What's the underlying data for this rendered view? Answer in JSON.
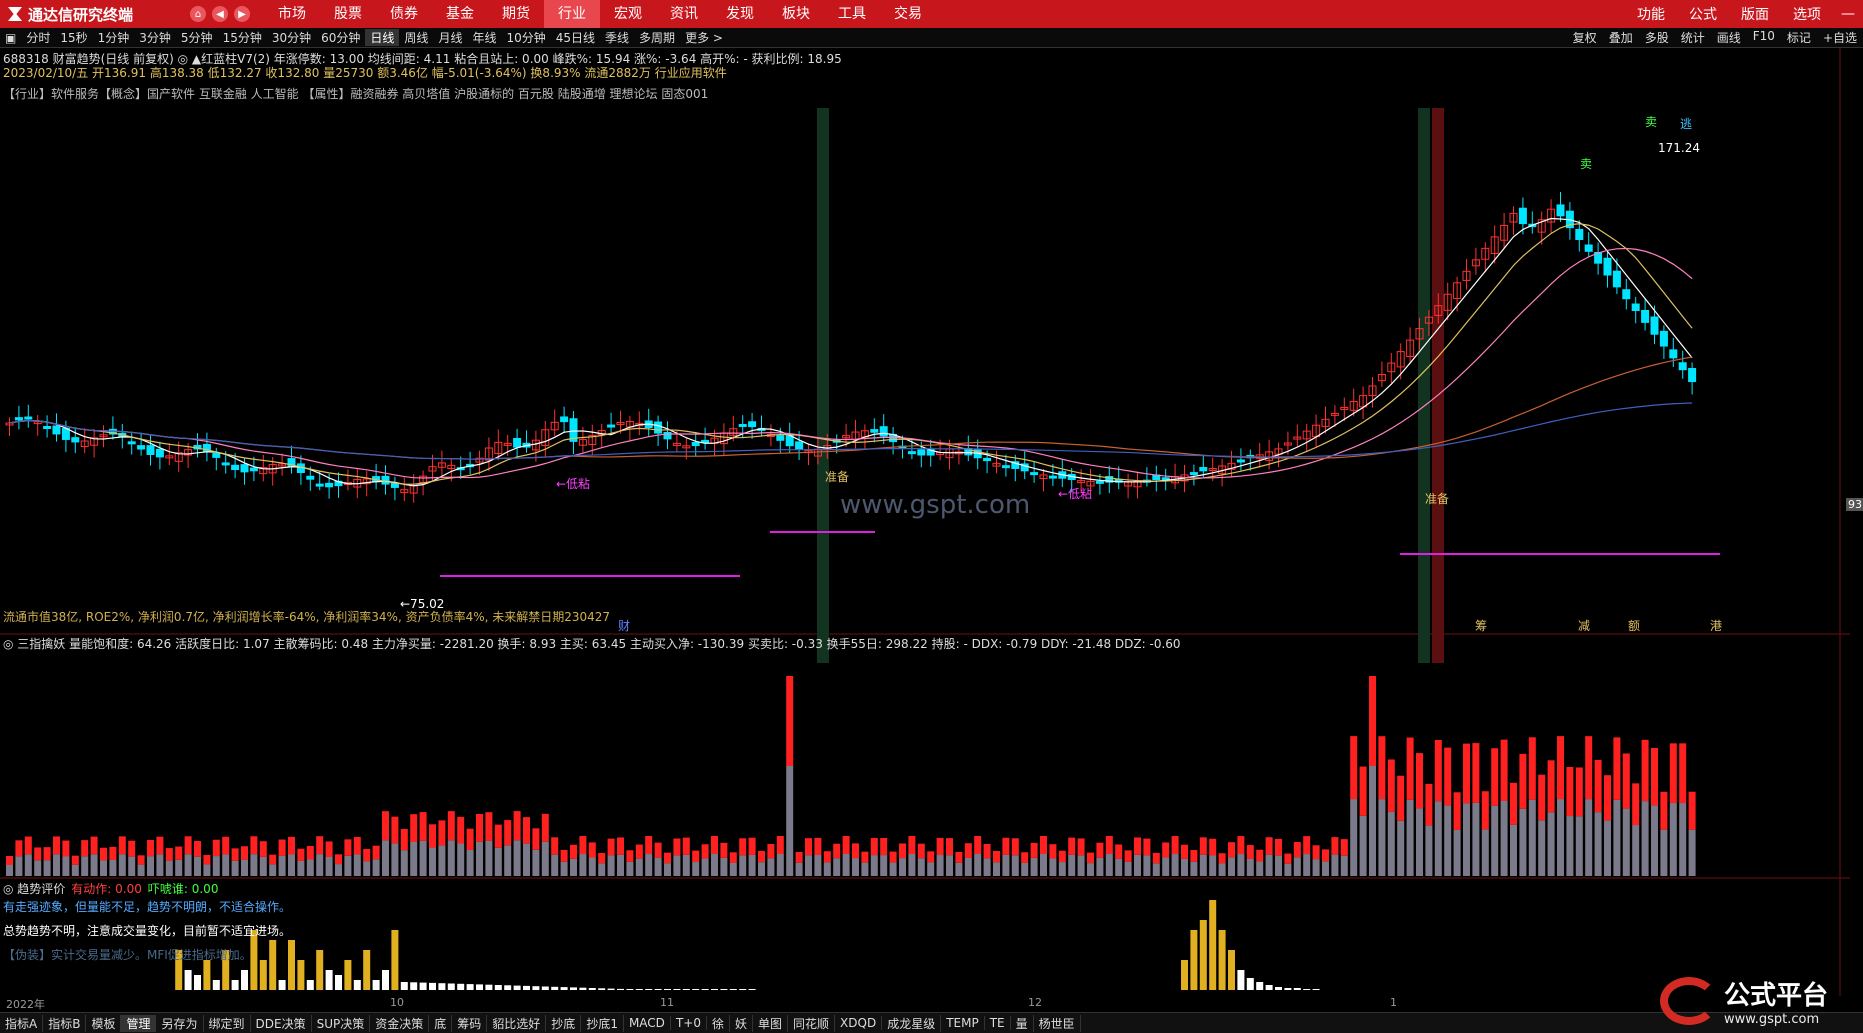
{
  "app": {
    "title": "通达信研究终端"
  },
  "menu": [
    "市场",
    "股票",
    "债券",
    "基金",
    "期货",
    "行业",
    "宏观",
    "资讯",
    "发现",
    "板块",
    "工具",
    "交易"
  ],
  "menu_active": "行业",
  "right_menu": [
    "功能",
    "公式",
    "版面",
    "选项"
  ],
  "timeframes": [
    "分时",
    "15秒",
    "1分钟",
    "3分钟",
    "5分钟",
    "15分钟",
    "30分钟",
    "60分钟",
    "日线",
    "周线",
    "月线",
    "年线",
    "10分钟",
    "45日线",
    "季线",
    "多周期",
    "更多 >"
  ],
  "timeframe_active": "日线",
  "tf_right": [
    "复权",
    "叠加",
    "多股",
    "统计",
    "画线",
    "F10",
    "标记",
    "+自选"
  ],
  "header": {
    "line1": "688318 财富趋势(日线 前复权) ◎ ▲红蓝柱V7(2) 年涨停数: 13.00 均线间距: 4.11 粘合且站上: 0.00 峰跌%: 15.94 涨%: -3.64 高开%: - 获利比例: 18.95",
    "line2": "2023/02/10/五 开136.91 高138.38 低132.27 收132.80 量25730 额3.46亿 幅-5.01(-3.64%) 换8.93% 流通2882万 行业应用软件",
    "line3": "【行业】软件服务【概念】国产软件 互联金融 人工智能 【属性】融资融券 高贝塔值 沪股通标的 百元股 陆股通增 理想论坛 固态001"
  },
  "price_labels": {
    "high": "171.24",
    "low": "75.02",
    "last": "93."
  },
  "markers": {
    "sell": "卖",
    "escape": "逃",
    "prepare": "准备",
    "lowstick": "←低粘"
  },
  "fin_info": "流通市值38亿, ROE2%, 净利润0.7亿, 净利润增长率-64%, 净利润率34%, 资产负债率4%, 未来解禁日期230427",
  "bottom_tags": [
    "财",
    "筹",
    "减",
    "额",
    "港"
  ],
  "indicator1": "◎ 三指擒妖 量能饱和度: 64.26 活跃度日比: 1.07 主散筹码比: 0.48 主力净买量: -2281.20 换手: 8.93 主买: 63.45 主动买入净: -130.39 买卖比: -0.33 换手55日: 298.22 持股: - DDX: -0.79 DDY: -21.48 DDZ: -0.60",
  "indicator2": {
    "title": "◎ 趋势评价",
    "a": "有动作: 0.00",
    "b": "吓唬谁: 0.00"
  },
  "trend_text": {
    "t1": "有走强迹象，但量能不足，趋势不明朗，不适合操作。",
    "t2": "总势趋势不明，注意成交量变化，目前暂不适宜进场。",
    "t3": "【伪装】实计交易量减少。MFI促进指标增加。"
  },
  "dates": [
    "2022年",
    "10",
    "11",
    "12",
    "1"
  ],
  "bottom_tabs": [
    "指标A",
    "指标B",
    "模板",
    "管理",
    "另存为",
    "绑定到",
    "DDE决策",
    "SUP决策",
    "资金决策",
    "底",
    "筹码",
    "貂比选好",
    "抄底",
    "抄底1",
    "MACD",
    "T+0",
    "徐",
    "妖",
    "单图",
    "同花顺",
    "XDQD",
    "成龙星级",
    "TEMP",
    "TE",
    "量",
    "杨世臣"
  ],
  "bottom_tab_active": "管理",
  "watermark": "www.gspt.com",
  "logo": {
    "name": "公式平台",
    "url": "www.gspt.com"
  },
  "colors": {
    "up": "#ff3030",
    "down": "#00e5ff",
    "brand_red": "#c8161d"
  }
}
